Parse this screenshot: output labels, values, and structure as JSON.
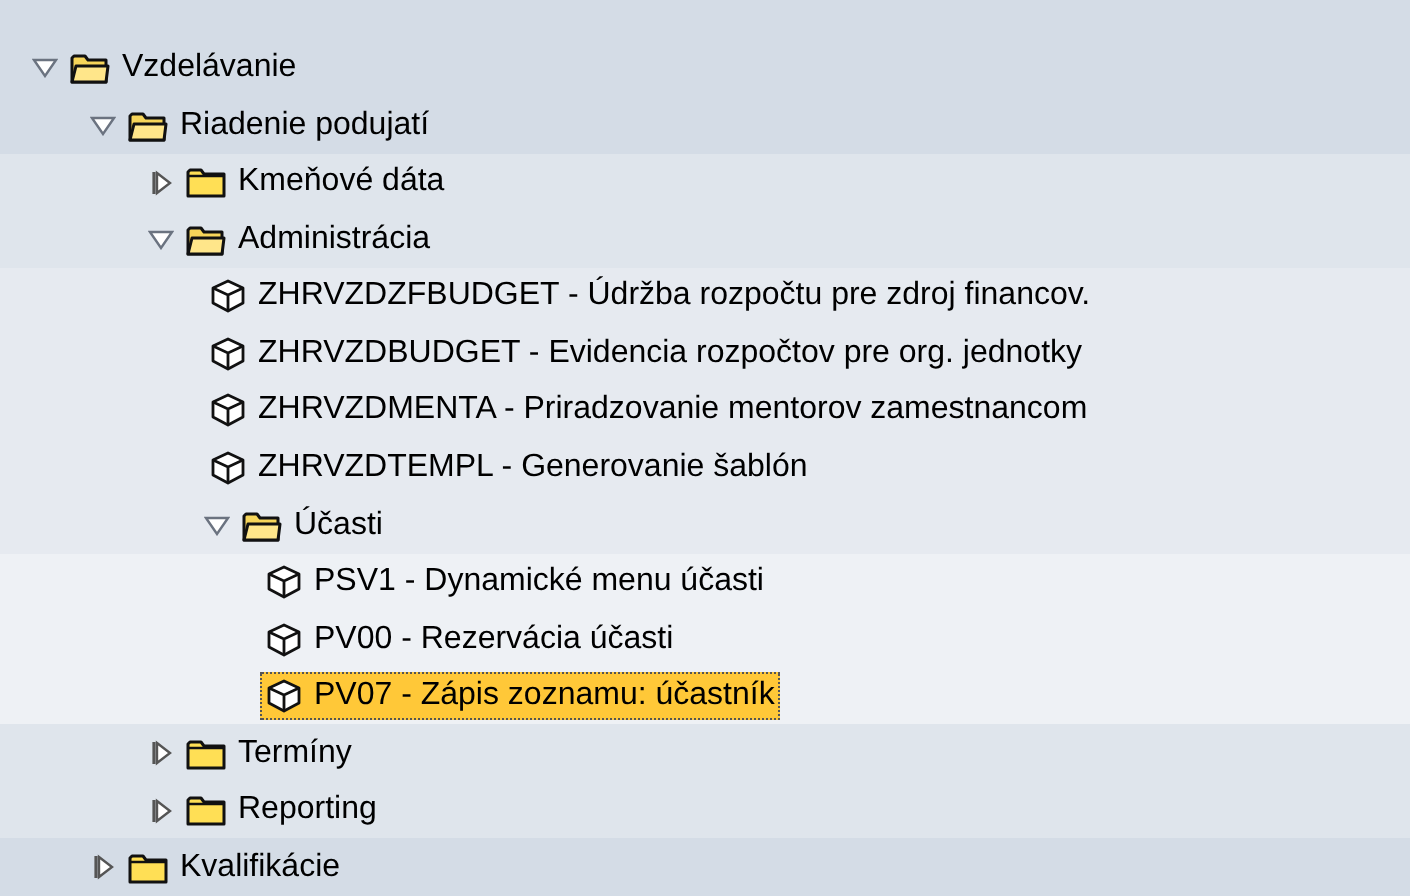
{
  "tree": [
    {
      "kind": "folder",
      "label": "Vzdelávanie",
      "expanded": true,
      "children": [
        {
          "kind": "folder",
          "label": "Riadenie podujatí",
          "expanded": true,
          "children": [
            {
              "kind": "folder",
              "label": "Kmeňové dáta",
              "expanded": false
            },
            {
              "kind": "folder",
              "label": "Administrácia",
              "expanded": true,
              "children": [
                {
                  "kind": "transaction",
                  "label": "ZHRVZDZFBUDGET - Údržba rozpočtu pre zdroj financov.",
                  "selected": false
                },
                {
                  "kind": "transaction",
                  "label": "ZHRVZDBUDGET - Evidencia rozpočtov pre org. jednotky",
                  "selected": false
                },
                {
                  "kind": "transaction",
                  "label": "ZHRVZDMENTA - Priradzovanie mentorov zamestnancom",
                  "selected": false
                },
                {
                  "kind": "transaction",
                  "label": "ZHRVZDTEMPL - Generovanie šablón",
                  "selected": false
                },
                {
                  "kind": "folder",
                  "label": "Účasti",
                  "expanded": true,
                  "children": [
                    {
                      "kind": "transaction",
                      "label": "PSV1 - Dynamické menu účasti",
                      "selected": false
                    },
                    {
                      "kind": "transaction",
                      "label": "PV00 - Rezervácia účasti",
                      "selected": false
                    },
                    {
                      "kind": "transaction",
                      "label": "PV07 - Zápis zoznamu: účastník",
                      "selected": true
                    }
                  ]
                }
              ]
            },
            {
              "kind": "folder",
              "label": "Termíny",
              "expanded": false
            },
            {
              "kind": "folder",
              "label": "Reporting",
              "expanded": false
            }
          ]
        },
        {
          "kind": "folder",
          "label": "Kvalifikácie",
          "expanded": false
        }
      ]
    }
  ]
}
